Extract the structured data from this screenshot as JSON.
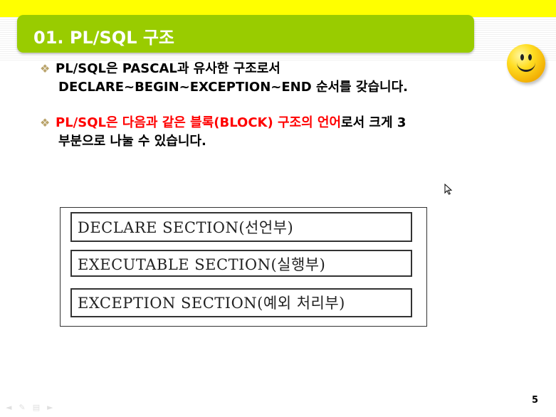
{
  "header": {
    "title": "01. PL/SQL 구조",
    "colors": {
      "topbar": "#ffff00",
      "title_bg": "#99cc00",
      "title_text": "#ffffff"
    }
  },
  "bullets": [
    {
      "line1": "PL/SQL은 PASCAL과 유사한 구조로서",
      "line2": "DECLARE~BEGIN~EXCEPTION~END 순서를 갖습니다."
    },
    {
      "line1_red": "PL/SQL은 다음과 같은 블록(BLOCK) 구조의 언어",
      "line1_black": "로서 크게 3",
      "line2": "부분으로 나눌 수 있습니다."
    }
  ],
  "bullet_mark": "❖",
  "diagram": {
    "sections": [
      "DECLARE SECTION(선언부)",
      "EXECUTABLE SECTION(실행부)",
      "EXCEPTION SECTION(예외 처리부)"
    ]
  },
  "icons": {
    "decoration": "smiley-face-icon",
    "pointer": "mouse-cursor-icon"
  },
  "footer": {
    "page_number": "5"
  }
}
